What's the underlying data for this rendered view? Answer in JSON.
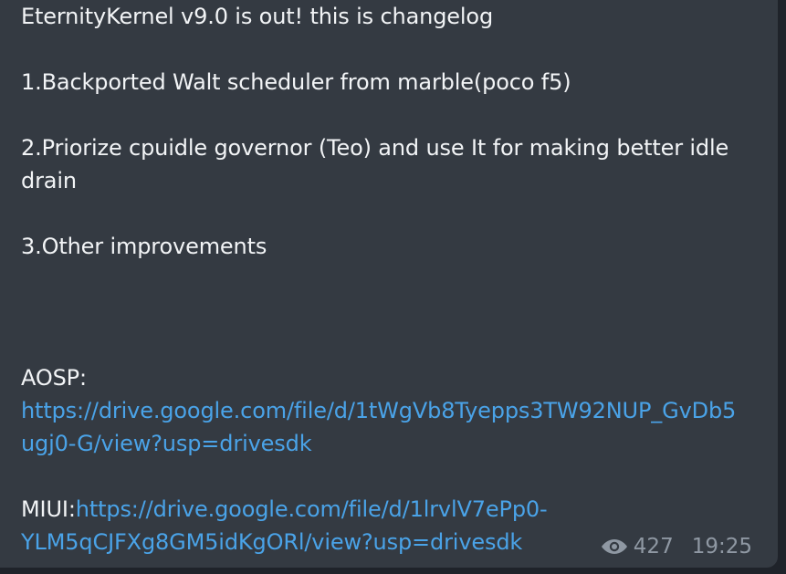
{
  "message": {
    "title_line": "EternityKernel v9.0 is out! this is changelog",
    "items": [
      "1.Backported Walt scheduler from marble(poco f5)",
      "2.Priorize cpuidle governor (Teo) and use It for making better idle",
      "drain",
      "3.Other improvements"
    ],
    "aosp_label": "AOSP:",
    "aosp_link_line1": "https://drive.google.com/file/d/1tWgVb8Tyepps3TW92NUP_GvDb5",
    "aosp_link_line2": "ugj0-G/view?usp=drivesdk",
    "miui_label": "MIUI:",
    "miui_link_line1": "https://drive.google.com/file/d/1lrvlV7ePp0-",
    "miui_link_line2": "YLM5qCJFXg8GM5idKgORl/view?usp=drivesdk"
  },
  "meta": {
    "views_icon": "eye-icon",
    "views": "427",
    "time": "19:25"
  },
  "colors": {
    "bubble": "#343a42",
    "text": "#f2f4f6",
    "link": "#4aa3e8",
    "meta": "#8f98a3"
  }
}
